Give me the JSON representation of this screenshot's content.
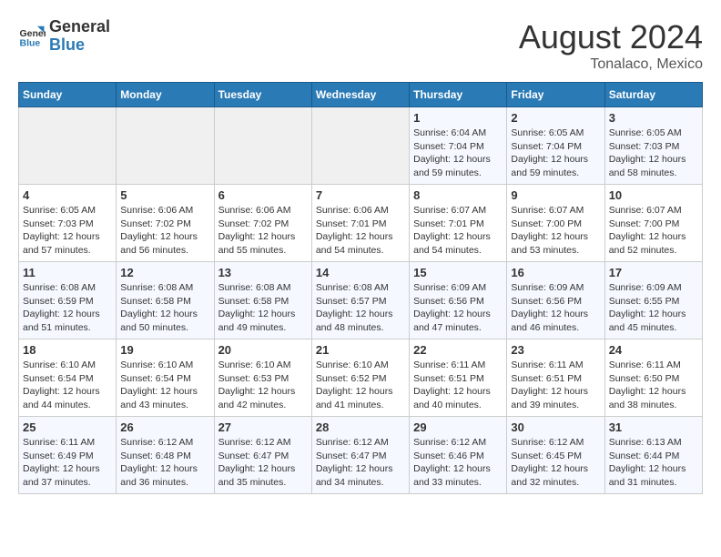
{
  "header": {
    "logo_general": "General",
    "logo_blue": "Blue",
    "month_year": "August 2024",
    "location": "Tonalaco, Mexico"
  },
  "days_of_week": [
    "Sunday",
    "Monday",
    "Tuesday",
    "Wednesday",
    "Thursday",
    "Friday",
    "Saturday"
  ],
  "weeks": [
    [
      {
        "day": "",
        "empty": true
      },
      {
        "day": "",
        "empty": true
      },
      {
        "day": "",
        "empty": true
      },
      {
        "day": "",
        "empty": true
      },
      {
        "day": "1",
        "sunrise": "6:04 AM",
        "sunset": "7:04 PM",
        "daylight": "12 hours and 59 minutes."
      },
      {
        "day": "2",
        "sunrise": "6:05 AM",
        "sunset": "7:04 PM",
        "daylight": "12 hours and 59 minutes."
      },
      {
        "day": "3",
        "sunrise": "6:05 AM",
        "sunset": "7:03 PM",
        "daylight": "12 hours and 58 minutes."
      }
    ],
    [
      {
        "day": "4",
        "sunrise": "6:05 AM",
        "sunset": "7:03 PM",
        "daylight": "12 hours and 57 minutes."
      },
      {
        "day": "5",
        "sunrise": "6:06 AM",
        "sunset": "7:02 PM",
        "daylight": "12 hours and 56 minutes."
      },
      {
        "day": "6",
        "sunrise": "6:06 AM",
        "sunset": "7:02 PM",
        "daylight": "12 hours and 55 minutes."
      },
      {
        "day": "7",
        "sunrise": "6:06 AM",
        "sunset": "7:01 PM",
        "daylight": "12 hours and 54 minutes."
      },
      {
        "day": "8",
        "sunrise": "6:07 AM",
        "sunset": "7:01 PM",
        "daylight": "12 hours and 54 minutes."
      },
      {
        "day": "9",
        "sunrise": "6:07 AM",
        "sunset": "7:00 PM",
        "daylight": "12 hours and 53 minutes."
      },
      {
        "day": "10",
        "sunrise": "6:07 AM",
        "sunset": "7:00 PM",
        "daylight": "12 hours and 52 minutes."
      }
    ],
    [
      {
        "day": "11",
        "sunrise": "6:08 AM",
        "sunset": "6:59 PM",
        "daylight": "12 hours and 51 minutes."
      },
      {
        "day": "12",
        "sunrise": "6:08 AM",
        "sunset": "6:58 PM",
        "daylight": "12 hours and 50 minutes."
      },
      {
        "day": "13",
        "sunrise": "6:08 AM",
        "sunset": "6:58 PM",
        "daylight": "12 hours and 49 minutes."
      },
      {
        "day": "14",
        "sunrise": "6:08 AM",
        "sunset": "6:57 PM",
        "daylight": "12 hours and 48 minutes."
      },
      {
        "day": "15",
        "sunrise": "6:09 AM",
        "sunset": "6:56 PM",
        "daylight": "12 hours and 47 minutes."
      },
      {
        "day": "16",
        "sunrise": "6:09 AM",
        "sunset": "6:56 PM",
        "daylight": "12 hours and 46 minutes."
      },
      {
        "day": "17",
        "sunrise": "6:09 AM",
        "sunset": "6:55 PM",
        "daylight": "12 hours and 45 minutes."
      }
    ],
    [
      {
        "day": "18",
        "sunrise": "6:10 AM",
        "sunset": "6:54 PM",
        "daylight": "12 hours and 44 minutes."
      },
      {
        "day": "19",
        "sunrise": "6:10 AM",
        "sunset": "6:54 PM",
        "daylight": "12 hours and 43 minutes."
      },
      {
        "day": "20",
        "sunrise": "6:10 AM",
        "sunset": "6:53 PM",
        "daylight": "12 hours and 42 minutes."
      },
      {
        "day": "21",
        "sunrise": "6:10 AM",
        "sunset": "6:52 PM",
        "daylight": "12 hours and 41 minutes."
      },
      {
        "day": "22",
        "sunrise": "6:11 AM",
        "sunset": "6:51 PM",
        "daylight": "12 hours and 40 minutes."
      },
      {
        "day": "23",
        "sunrise": "6:11 AM",
        "sunset": "6:51 PM",
        "daylight": "12 hours and 39 minutes."
      },
      {
        "day": "24",
        "sunrise": "6:11 AM",
        "sunset": "6:50 PM",
        "daylight": "12 hours and 38 minutes."
      }
    ],
    [
      {
        "day": "25",
        "sunrise": "6:11 AM",
        "sunset": "6:49 PM",
        "daylight": "12 hours and 37 minutes."
      },
      {
        "day": "26",
        "sunrise": "6:12 AM",
        "sunset": "6:48 PM",
        "daylight": "12 hours and 36 minutes."
      },
      {
        "day": "27",
        "sunrise": "6:12 AM",
        "sunset": "6:47 PM",
        "daylight": "12 hours and 35 minutes."
      },
      {
        "day": "28",
        "sunrise": "6:12 AM",
        "sunset": "6:47 PM",
        "daylight": "12 hours and 34 minutes."
      },
      {
        "day": "29",
        "sunrise": "6:12 AM",
        "sunset": "6:46 PM",
        "daylight": "12 hours and 33 minutes."
      },
      {
        "day": "30",
        "sunrise": "6:12 AM",
        "sunset": "6:45 PM",
        "daylight": "12 hours and 32 minutes."
      },
      {
        "day": "31",
        "sunrise": "6:13 AM",
        "sunset": "6:44 PM",
        "daylight": "12 hours and 31 minutes."
      }
    ]
  ]
}
